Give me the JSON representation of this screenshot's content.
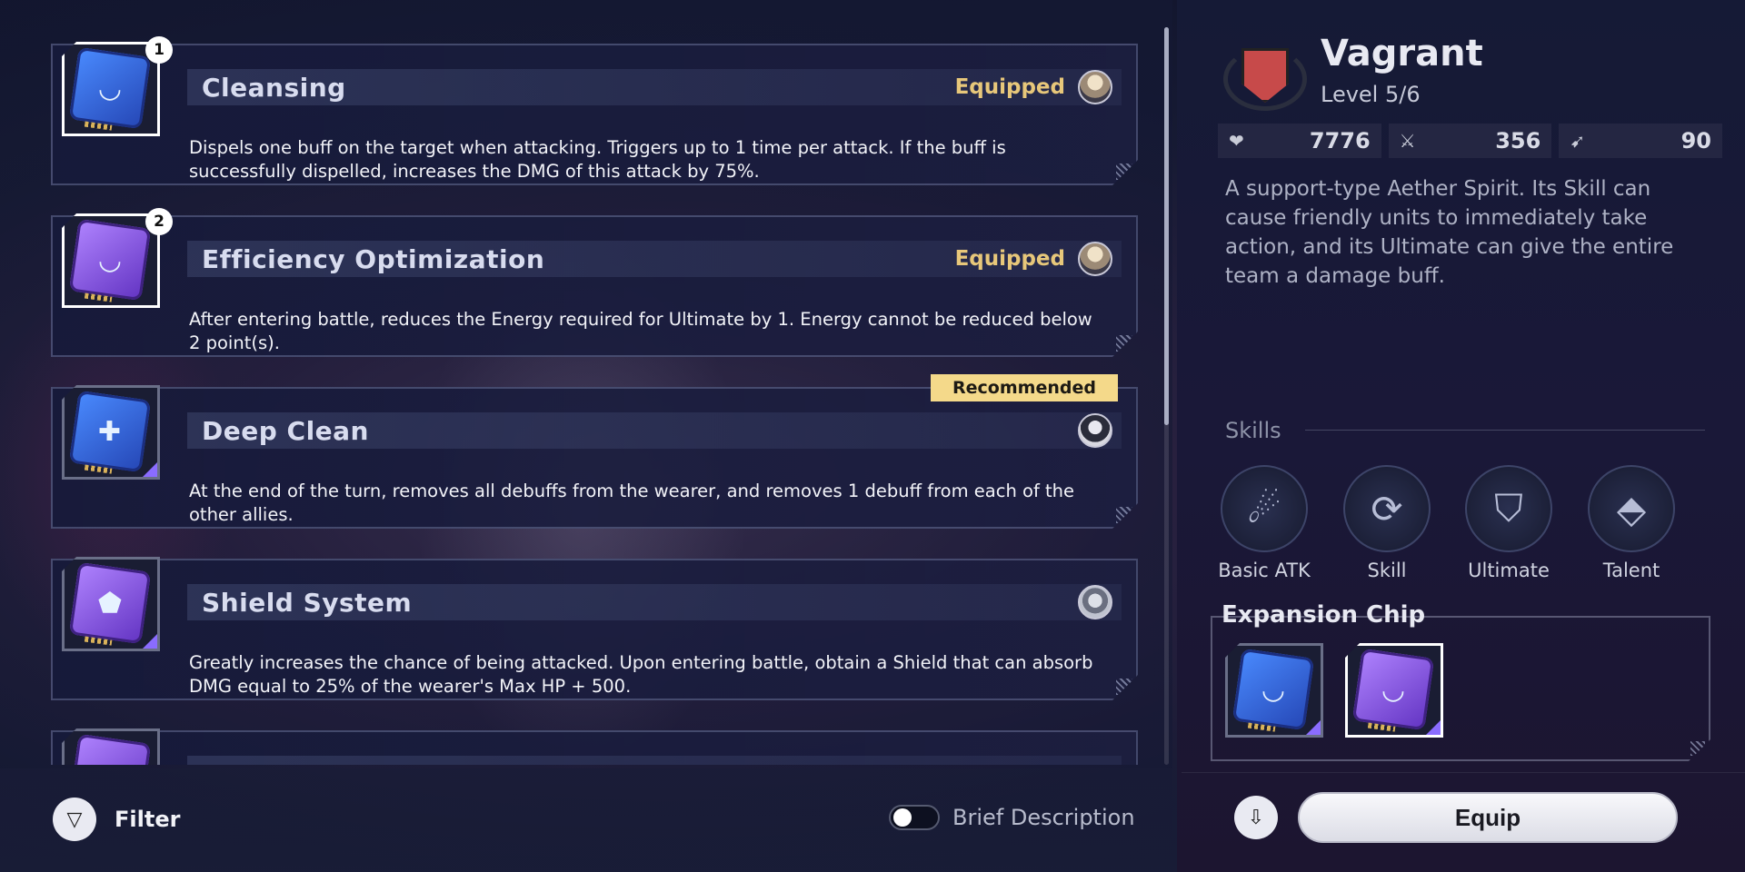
{
  "chips": [
    {
      "name": "Cleansing",
      "description": "Dispels one buff on the target when attacking. Triggers up to 1 time per attack. If the buff is successfully dispelled, increases the DMG of this attack by 75%.",
      "status": "Equipped",
      "slot_number": "1",
      "color": "blue",
      "symbol": "◡",
      "icon": "cleansing-chip-icon"
    },
    {
      "name": "Efficiency Optimization",
      "description": "After entering battle, reduces the Energy required for Ultimate by 1. Energy cannot be reduced below 2 point(s).",
      "status": "Equipped",
      "slot_number": "2",
      "color": "purple",
      "symbol": "◡",
      "icon": "efficiency-chip-icon"
    },
    {
      "name": "Deep Clean",
      "description": "At the end of the turn, removes all debuffs from the wearer, and removes 1 debuff from each of the other allies.",
      "tag": "Recommended",
      "color": "blue",
      "symbol": "✚",
      "icon": "deep-clean-chip-icon"
    },
    {
      "name": "Shield System",
      "description": "Greatly increases the chance of being attacked. Upon entering battle, obtain a Shield that can absorb DMG equal to 25% of the wearer's Max HP + 500.",
      "color": "purple",
      "symbol": "⬟",
      "icon": "shield-chip-icon"
    },
    {
      "name": "",
      "description": "",
      "color": "purple",
      "symbol": "◣",
      "icon": "partial-chip-icon"
    }
  ],
  "bottom": {
    "filter_label": "Filter",
    "toggle_label": "Brief Description"
  },
  "spirit": {
    "name": "Vagrant",
    "level": "Level 5/6",
    "stats": {
      "hp": "7776",
      "atk": "356",
      "speed": "90"
    },
    "description": "A support-type Aether Spirit. Its Skill can cause friendly units to immediately take action, and its Ultimate can give the entire team a damage buff."
  },
  "skills": {
    "header": "Skills",
    "items": [
      {
        "label": "Basic ATK",
        "icon": "basic-atk-icon",
        "glyph": "☄"
      },
      {
        "label": "Skill",
        "icon": "skill-icon",
        "glyph": "⟳"
      },
      {
        "label": "Ultimate",
        "icon": "ultimate-icon",
        "glyph": "⛉"
      },
      {
        "label": "Talent",
        "icon": "talent-icon",
        "glyph": "⬘"
      }
    ]
  },
  "expansion_chip": {
    "header": "Expansion Chip"
  },
  "actions": {
    "equip_label": "Equip"
  }
}
